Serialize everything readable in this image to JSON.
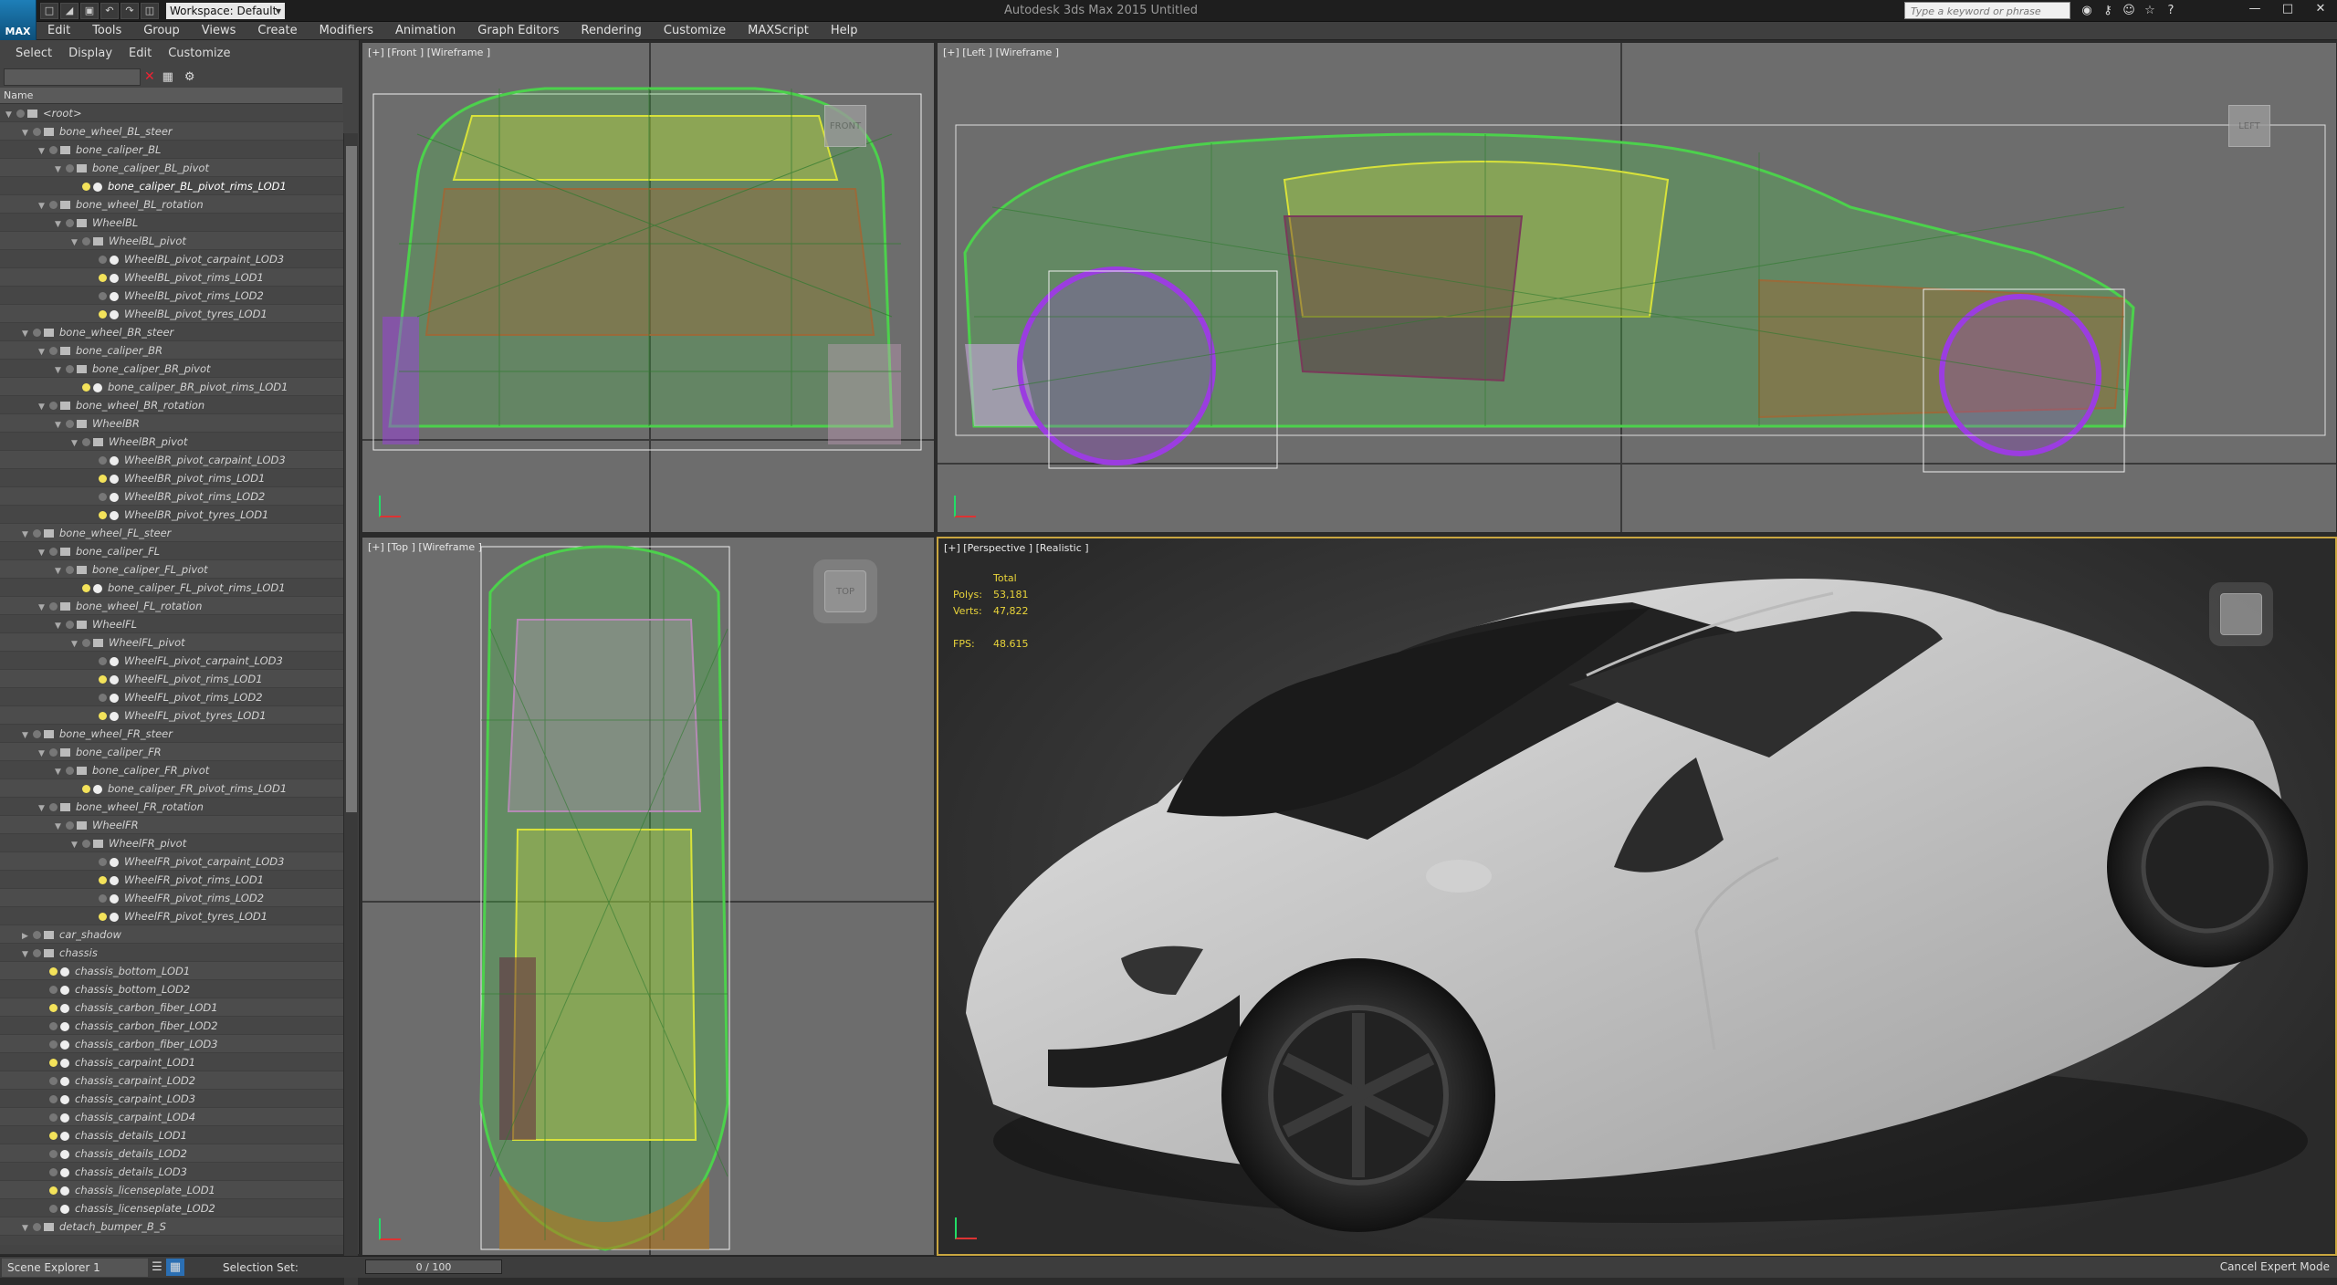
{
  "titlebar": {
    "workspace": "Workspace: Default",
    "app_title": "Autodesk 3ds Max 2015    Untitled",
    "search_placeholder": "Type a keyword or phrase"
  },
  "app_logo": "MAX",
  "menu": [
    "Edit",
    "Tools",
    "Group",
    "Views",
    "Create",
    "Modifiers",
    "Animation",
    "Graph Editors",
    "Rendering",
    "Customize",
    "MAXScript",
    "Help"
  ],
  "explorer": {
    "tabs": [
      "Select",
      "Display",
      "Edit",
      "Customize"
    ],
    "column_header": "Name",
    "rows": [
      {
        "label": "<root>",
        "d": 0,
        "type": "grp"
      },
      {
        "label": "bone_wheel_BL_steer",
        "d": 1,
        "type": "grp"
      },
      {
        "label": "bone_caliper_BL",
        "d": 2,
        "type": "grp"
      },
      {
        "label": "bone_caliper_BL_pivot",
        "d": 3,
        "type": "grp"
      },
      {
        "label": "bone_caliper_BL_pivot_rims_LOD1",
        "d": 4,
        "type": "obj",
        "vis": true,
        "sel": true
      },
      {
        "label": "bone_wheel_BL_rotation",
        "d": 2,
        "type": "grp"
      },
      {
        "label": "WheelBL",
        "d": 3,
        "type": "grp"
      },
      {
        "label": "WheelBL_pivot",
        "d": 4,
        "type": "grp"
      },
      {
        "label": "WheelBL_pivot_carpaint_LOD3",
        "d": 5,
        "type": "obj"
      },
      {
        "label": "WheelBL_pivot_rims_LOD1",
        "d": 5,
        "type": "obj",
        "vis": true
      },
      {
        "label": "WheelBL_pivot_rims_LOD2",
        "d": 5,
        "type": "obj"
      },
      {
        "label": "WheelBL_pivot_tyres_LOD1",
        "d": 5,
        "type": "obj",
        "vis": true
      },
      {
        "label": "bone_wheel_BR_steer",
        "d": 1,
        "type": "grp"
      },
      {
        "label": "bone_caliper_BR",
        "d": 2,
        "type": "grp"
      },
      {
        "label": "bone_caliper_BR_pivot",
        "d": 3,
        "type": "grp"
      },
      {
        "label": "bone_caliper_BR_pivot_rims_LOD1",
        "d": 4,
        "type": "obj",
        "vis": true
      },
      {
        "label": "bone_wheel_BR_rotation",
        "d": 2,
        "type": "grp"
      },
      {
        "label": "WheelBR",
        "d": 3,
        "type": "grp"
      },
      {
        "label": "WheelBR_pivot",
        "d": 4,
        "type": "grp"
      },
      {
        "label": "WheelBR_pivot_carpaint_LOD3",
        "d": 5,
        "type": "obj"
      },
      {
        "label": "WheelBR_pivot_rims_LOD1",
        "d": 5,
        "type": "obj",
        "vis": true
      },
      {
        "label": "WheelBR_pivot_rims_LOD2",
        "d": 5,
        "type": "obj"
      },
      {
        "label": "WheelBR_pivot_tyres_LOD1",
        "d": 5,
        "type": "obj",
        "vis": true
      },
      {
        "label": "bone_wheel_FL_steer",
        "d": 1,
        "type": "grp"
      },
      {
        "label": "bone_caliper_FL",
        "d": 2,
        "type": "grp"
      },
      {
        "label": "bone_caliper_FL_pivot",
        "d": 3,
        "type": "grp"
      },
      {
        "label": "bone_caliper_FL_pivot_rims_LOD1",
        "d": 4,
        "type": "obj",
        "vis": true
      },
      {
        "label": "bone_wheel_FL_rotation",
        "d": 2,
        "type": "grp"
      },
      {
        "label": "WheelFL",
        "d": 3,
        "type": "grp"
      },
      {
        "label": "WheelFL_pivot",
        "d": 4,
        "type": "grp"
      },
      {
        "label": "WheelFL_pivot_carpaint_LOD3",
        "d": 5,
        "type": "obj"
      },
      {
        "label": "WheelFL_pivot_rims_LOD1",
        "d": 5,
        "type": "obj",
        "vis": true
      },
      {
        "label": "WheelFL_pivot_rims_LOD2",
        "d": 5,
        "type": "obj"
      },
      {
        "label": "WheelFL_pivot_tyres_LOD1",
        "d": 5,
        "type": "obj",
        "vis": true
      },
      {
        "label": "bone_wheel_FR_steer",
        "d": 1,
        "type": "grp"
      },
      {
        "label": "bone_caliper_FR",
        "d": 2,
        "type": "grp"
      },
      {
        "label": "bone_caliper_FR_pivot",
        "d": 3,
        "type": "grp"
      },
      {
        "label": "bone_caliper_FR_pivot_rims_LOD1",
        "d": 4,
        "type": "obj",
        "vis": true
      },
      {
        "label": "bone_wheel_FR_rotation",
        "d": 2,
        "type": "grp"
      },
      {
        "label": "WheelFR",
        "d": 3,
        "type": "grp"
      },
      {
        "label": "WheelFR_pivot",
        "d": 4,
        "type": "grp"
      },
      {
        "label": "WheelFR_pivot_carpaint_LOD3",
        "d": 5,
        "type": "obj"
      },
      {
        "label": "WheelFR_pivot_rims_LOD1",
        "d": 5,
        "type": "obj",
        "vis": true
      },
      {
        "label": "WheelFR_pivot_rims_LOD2",
        "d": 5,
        "type": "obj"
      },
      {
        "label": "WheelFR_pivot_tyres_LOD1",
        "d": 5,
        "type": "obj",
        "vis": true
      },
      {
        "label": "car_shadow",
        "d": 1,
        "type": "grp",
        "collapsed": true
      },
      {
        "label": "chassis",
        "d": 1,
        "type": "grp"
      },
      {
        "label": "chassis_bottom_LOD1",
        "d": 2,
        "type": "obj",
        "vis": true
      },
      {
        "label": "chassis_bottom_LOD2",
        "d": 2,
        "type": "obj"
      },
      {
        "label": "chassis_carbon_fiber_LOD1",
        "d": 2,
        "type": "obj",
        "vis": true
      },
      {
        "label": "chassis_carbon_fiber_LOD2",
        "d": 2,
        "type": "obj"
      },
      {
        "label": "chassis_carbon_fiber_LOD3",
        "d": 2,
        "type": "obj"
      },
      {
        "label": "chassis_carpaint_LOD1",
        "d": 2,
        "type": "obj",
        "vis": true
      },
      {
        "label": "chassis_carpaint_LOD2",
        "d": 2,
        "type": "obj"
      },
      {
        "label": "chassis_carpaint_LOD3",
        "d": 2,
        "type": "obj"
      },
      {
        "label": "chassis_carpaint_LOD4",
        "d": 2,
        "type": "obj"
      },
      {
        "label": "chassis_details_LOD1",
        "d": 2,
        "type": "obj",
        "vis": true
      },
      {
        "label": "chassis_details_LOD2",
        "d": 2,
        "type": "obj"
      },
      {
        "label": "chassis_details_LOD3",
        "d": 2,
        "type": "obj"
      },
      {
        "label": "chassis_licenseplate_LOD1",
        "d": 2,
        "type": "obj",
        "vis": true
      },
      {
        "label": "chassis_licenseplate_LOD2",
        "d": 2,
        "type": "obj"
      },
      {
        "label": "detach_bumper_B_S",
        "d": 1,
        "type": "grp"
      }
    ]
  },
  "viewports": {
    "front": "[+] [Front ] [Wireframe ]",
    "left": "[+] [Left ] [Wireframe ]",
    "top": "[+] [Top ] [Wireframe ]",
    "perspective": "[+] [Perspective ] [Realistic ]",
    "cube_front": "FRONT",
    "cube_left": "LEFT",
    "cube_top": "TOP"
  },
  "stats": {
    "header": "Total",
    "polys_label": "Polys:",
    "polys": "53,181",
    "verts_label": "Verts:",
    "verts": "47,822",
    "fps_label": "FPS:",
    "fps": "48.615"
  },
  "statusbar": {
    "explorer": "Scene Explorer 1",
    "selection_set": "Selection Set:",
    "time": "0 / 100",
    "mode": "Cancel Expert Mode"
  },
  "colors": {
    "wire_green": "#4cd14c",
    "wire_yellow": "#d8e23a",
    "wire_purple": "#9b3de0",
    "wire_brown": "#9a6a3a",
    "viewport_active": "#c9a640"
  }
}
